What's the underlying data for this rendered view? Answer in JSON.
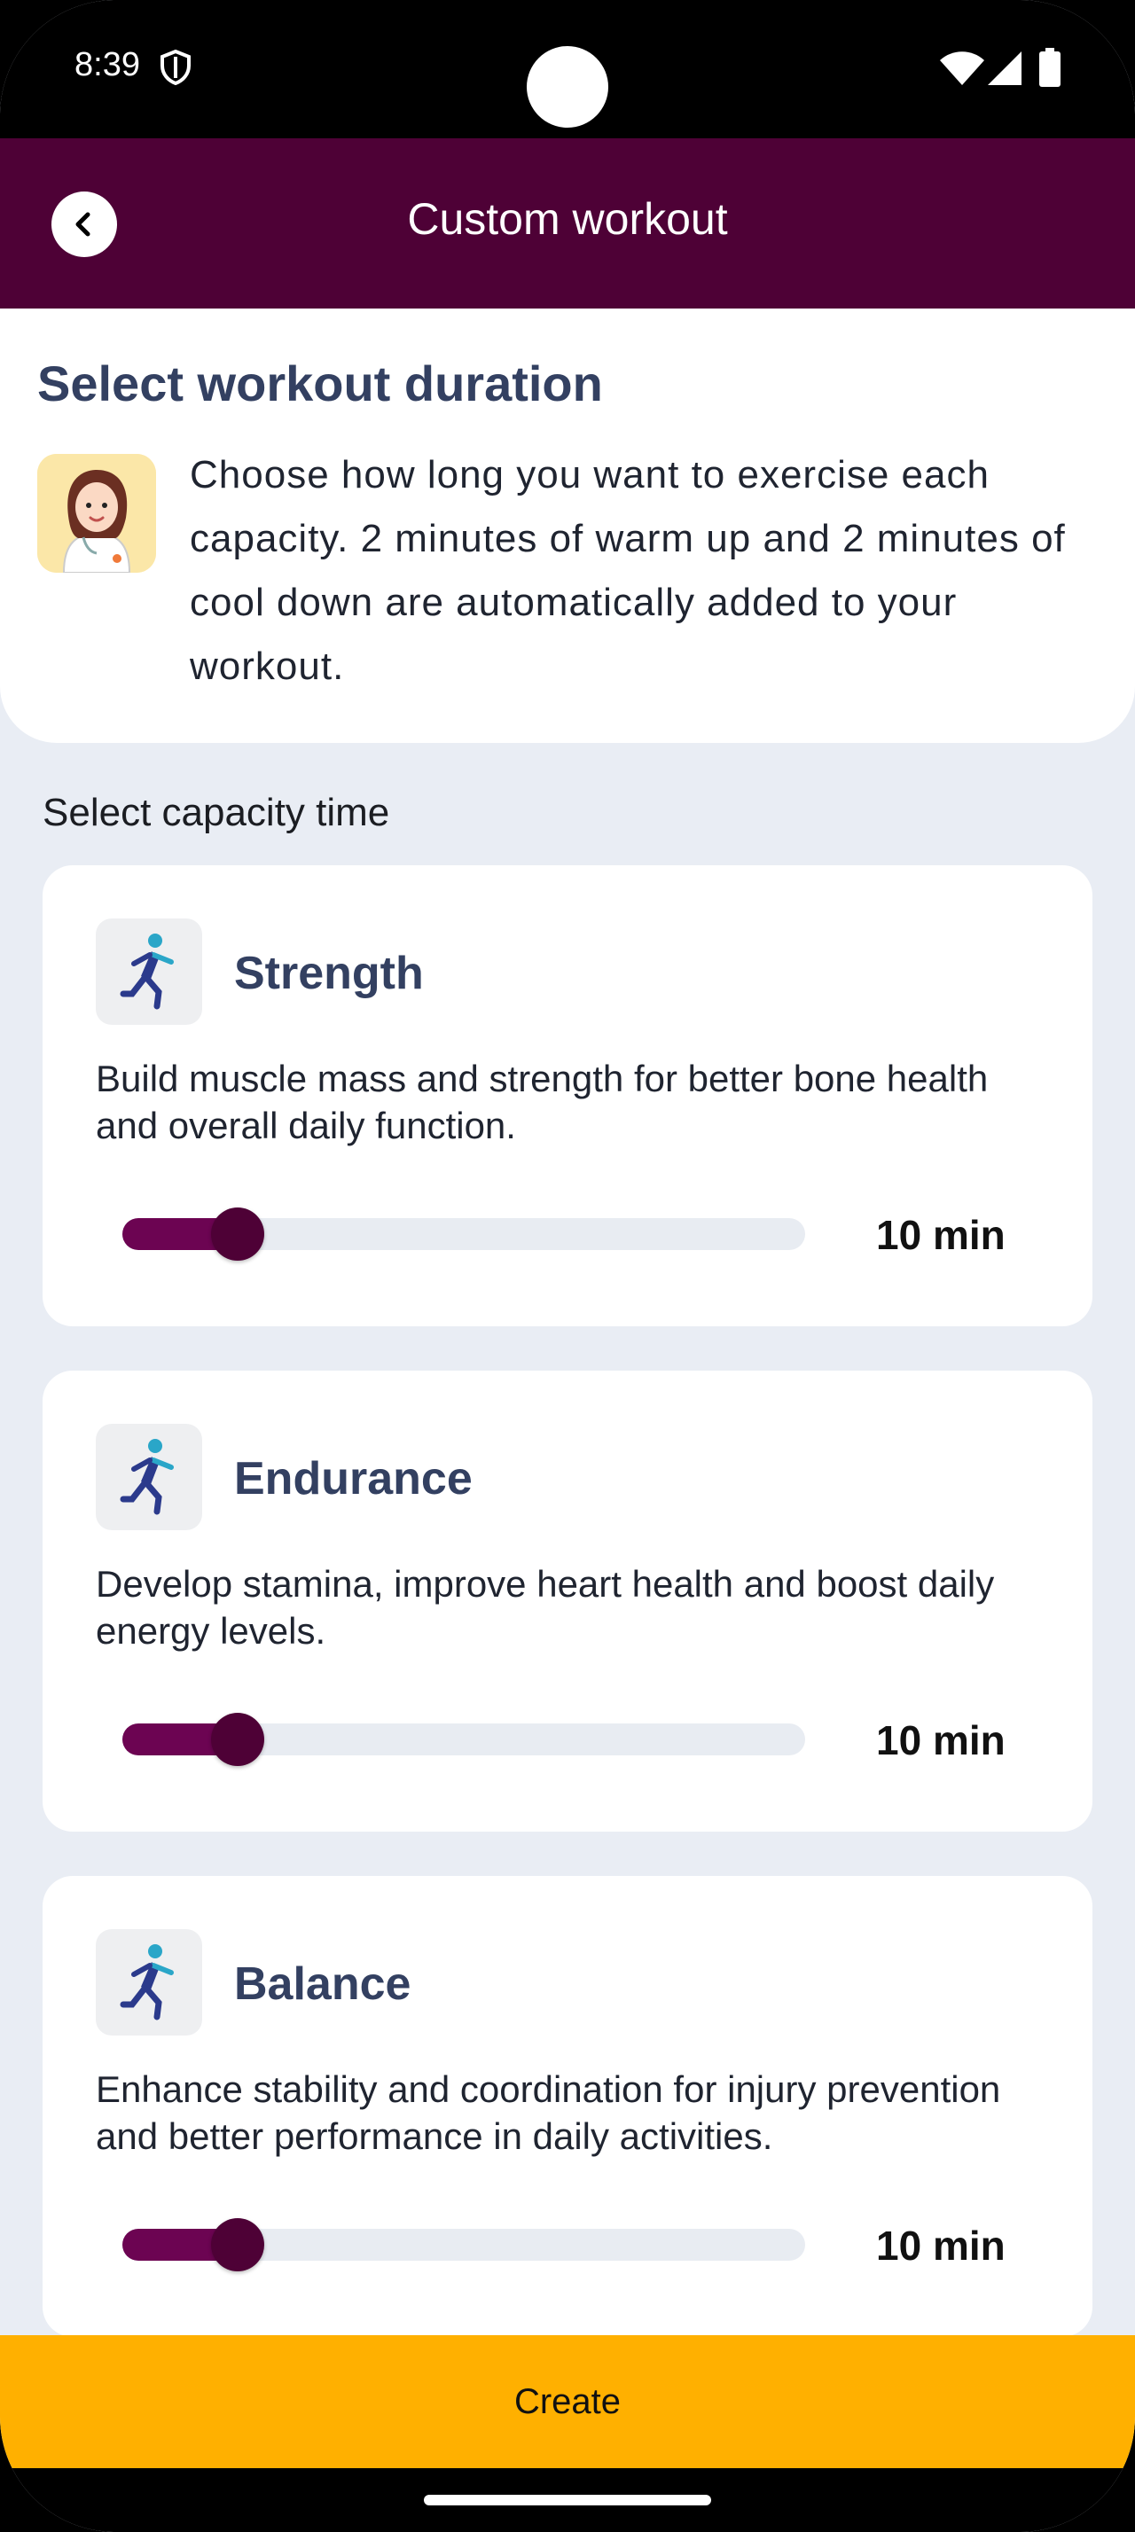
{
  "status_bar": {
    "time": "8:39",
    "icons": [
      "shield-icon",
      "wifi-icon",
      "signal-icon",
      "battery-icon"
    ]
  },
  "app_bar": {
    "title": "Custom workout",
    "back_icon": "chevron-left-icon"
  },
  "header": {
    "title": "Select workout duration",
    "description": "Choose how long you want to exercise each capacity. 2 minutes of warm up and 2 minutes of cool down are automatically added to your workout."
  },
  "capacity_section_label": "Select capacity time",
  "capacities": [
    {
      "name": "Strength",
      "description": "Build muscle mass and strength for better bone health and overall daily function.",
      "value_label": "10 min",
      "slider_fraction": 0.17
    },
    {
      "name": "Endurance",
      "description": "Develop stamina, improve heart health and boost daily energy levels.",
      "value_label": "10 min",
      "slider_fraction": 0.17
    },
    {
      "name": "Balance",
      "description": "Enhance stability and coordination for injury prevention and better performance in daily activities.",
      "value_label": "10 min",
      "slider_fraction": 0.17
    }
  ],
  "create_button": "Create",
  "colors": {
    "app_bar": "#4e0136",
    "accent": "#6c0452",
    "title_text": "#334061",
    "background": "#e9edf4",
    "create_button": "#ffb000"
  }
}
